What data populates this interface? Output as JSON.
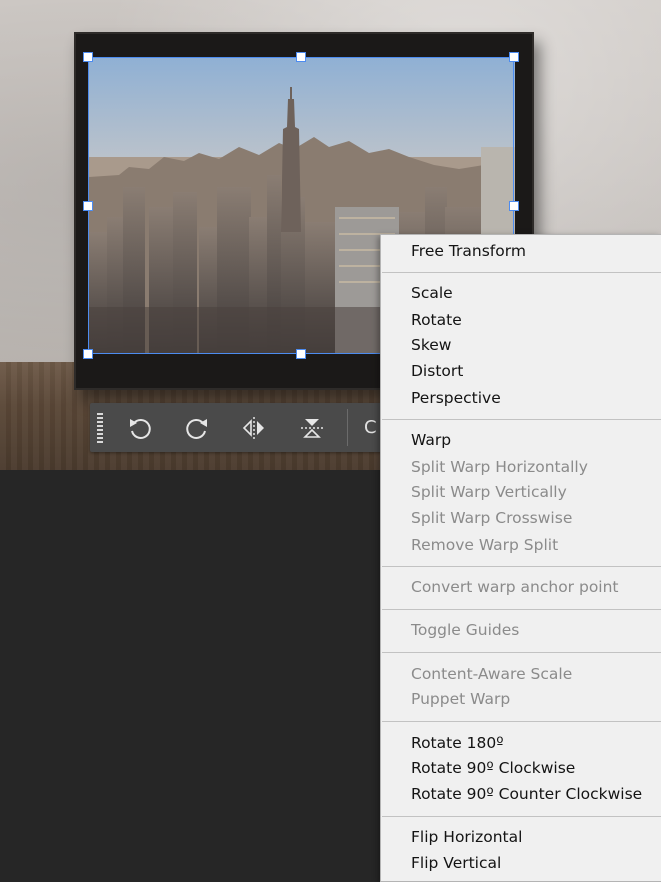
{
  "canvas": {
    "description_colors": {
      "wall": "#c9c4c0",
      "frame": "#1b1918",
      "table": "#5a4737",
      "selection": "#4d8cf0",
      "workspace": "#262626"
    }
  },
  "toolbar": {
    "buttons": [
      {
        "name": "rotate-ccw-icon"
      },
      {
        "name": "rotate-cw-icon"
      },
      {
        "name": "flip-horizontal-icon"
      },
      {
        "name": "flip-vertical-icon"
      }
    ],
    "more_label": "C"
  },
  "menu": {
    "items": [
      {
        "label": "Free Transform",
        "enabled": true
      },
      {
        "label": "Scale",
        "enabled": true
      },
      {
        "label": "Rotate",
        "enabled": true
      },
      {
        "label": "Skew",
        "enabled": true
      },
      {
        "label": "Distort",
        "enabled": true
      },
      {
        "label": "Perspective",
        "enabled": true
      },
      {
        "label": "Warp",
        "enabled": true
      },
      {
        "label": "Split Warp Horizontally",
        "enabled": false
      },
      {
        "label": "Split Warp Vertically",
        "enabled": false
      },
      {
        "label": "Split Warp Crosswise",
        "enabled": false
      },
      {
        "label": "Remove Warp Split",
        "enabled": false
      },
      {
        "label": "Convert warp anchor point",
        "enabled": false
      },
      {
        "label": "Toggle Guides",
        "enabled": false
      },
      {
        "label": "Content-Aware Scale",
        "enabled": false
      },
      {
        "label": "Puppet Warp",
        "enabled": false
      },
      {
        "label": "Rotate 180º",
        "enabled": true
      },
      {
        "label": "Rotate 90º Clockwise",
        "enabled": true
      },
      {
        "label": "Rotate 90º Counter Clockwise",
        "enabled": true
      },
      {
        "label": "Flip Horizontal",
        "enabled": true
      },
      {
        "label": "Flip Vertical",
        "enabled": true
      }
    ]
  }
}
